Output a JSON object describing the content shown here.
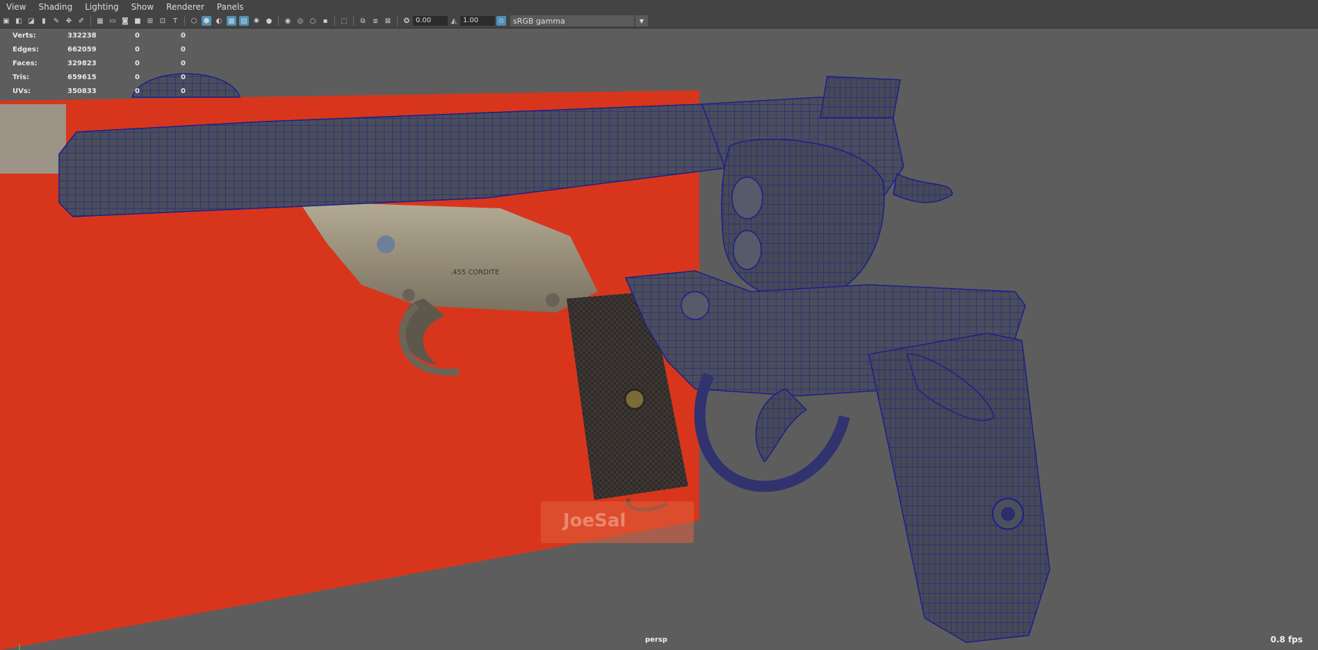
{
  "menu": [
    "View",
    "Shading",
    "Lighting",
    "Show",
    "Renderer",
    "Panels"
  ],
  "toolbar": {
    "exposure_value": "0.00",
    "gamma_value": "1.00",
    "color_space": "sRGB gamma"
  },
  "hud": {
    "rows": [
      {
        "label": "Verts:",
        "v1": "332238",
        "v2": "0",
        "v3": "0"
      },
      {
        "label": "Edges:",
        "v1": "662059",
        "v2": "0",
        "v3": "0"
      },
      {
        "label": "Faces:",
        "v1": "329823",
        "v2": "0",
        "v3": "0"
      },
      {
        "label": "Tris:",
        "v1": "659615",
        "v2": "0",
        "v3": "0"
      },
      {
        "label": "UVs:",
        "v1": "350833",
        "v2": "0",
        "v3": "0"
      }
    ]
  },
  "viewport": {
    "camera": "persp",
    "fps": "0.8 fps",
    "engraving": ".455 CORDITE",
    "watermark": "JoeSal"
  },
  "colors": {
    "background": "#5d5d5d",
    "ref_red": "#d8361c",
    "wire": "#1b1f8a",
    "mesh": "#4c4f5c"
  }
}
